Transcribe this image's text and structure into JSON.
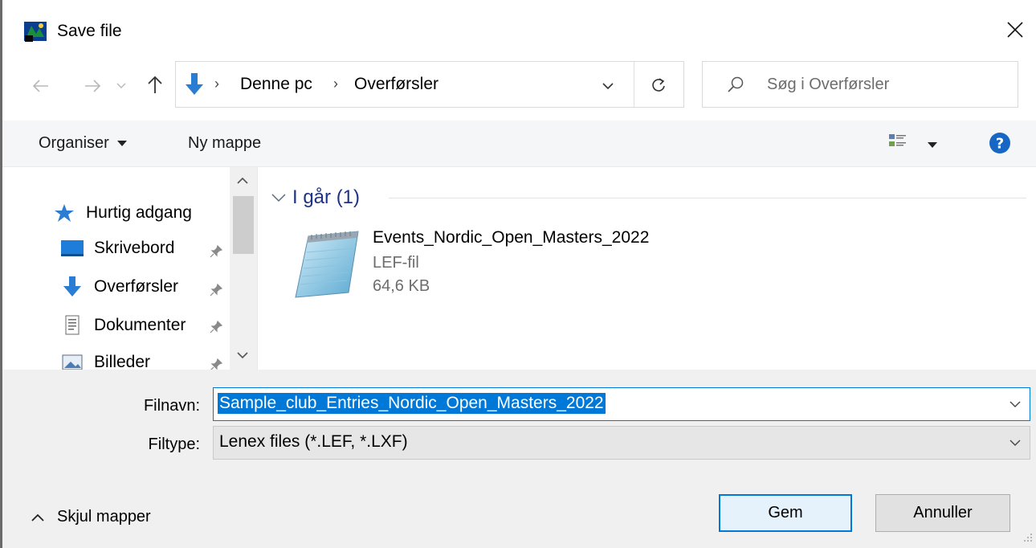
{
  "window": {
    "title": "Save file"
  },
  "nav": {
    "path": [
      "Denne pc",
      "Overførsler"
    ],
    "search_placeholder": "Søg i Overførsler"
  },
  "toolbar": {
    "organise_label": "Organiser",
    "new_folder_label": "Ny mappe"
  },
  "sidebar": {
    "items": [
      {
        "label": "Hurtig adgang",
        "icon": "star-icon"
      },
      {
        "label": "Skrivebord",
        "icon": "desktop-icon",
        "pinned": true
      },
      {
        "label": "Overførsler",
        "icon": "download-icon",
        "pinned": true
      },
      {
        "label": "Dokumenter",
        "icon": "document-icon",
        "pinned": true
      },
      {
        "label": "Billeder",
        "icon": "pictures-icon",
        "pinned": true
      }
    ]
  },
  "content": {
    "group_label": "I går (1)",
    "files": [
      {
        "name": "Events_Nordic_Open_Masters_2022",
        "type": "LEF-fil",
        "size": "64,6 KB",
        "icon": "notepad-file-icon"
      }
    ]
  },
  "form": {
    "filename_label": "Filnavn:",
    "filename_value": "Sample_club_Entries_Nordic_Open_Masters_2022",
    "filetype_label": "Filtype:",
    "filetype_value": "Lenex files (*.LEF, *.LXF)",
    "hide_folders_label": "Skjul mapper",
    "save_label": "Gem",
    "cancel_label": "Annuller"
  },
  "colors": {
    "accent": "#0078d7",
    "group_header": "#1e3287",
    "bottom_panel": "#f0f0f0"
  }
}
